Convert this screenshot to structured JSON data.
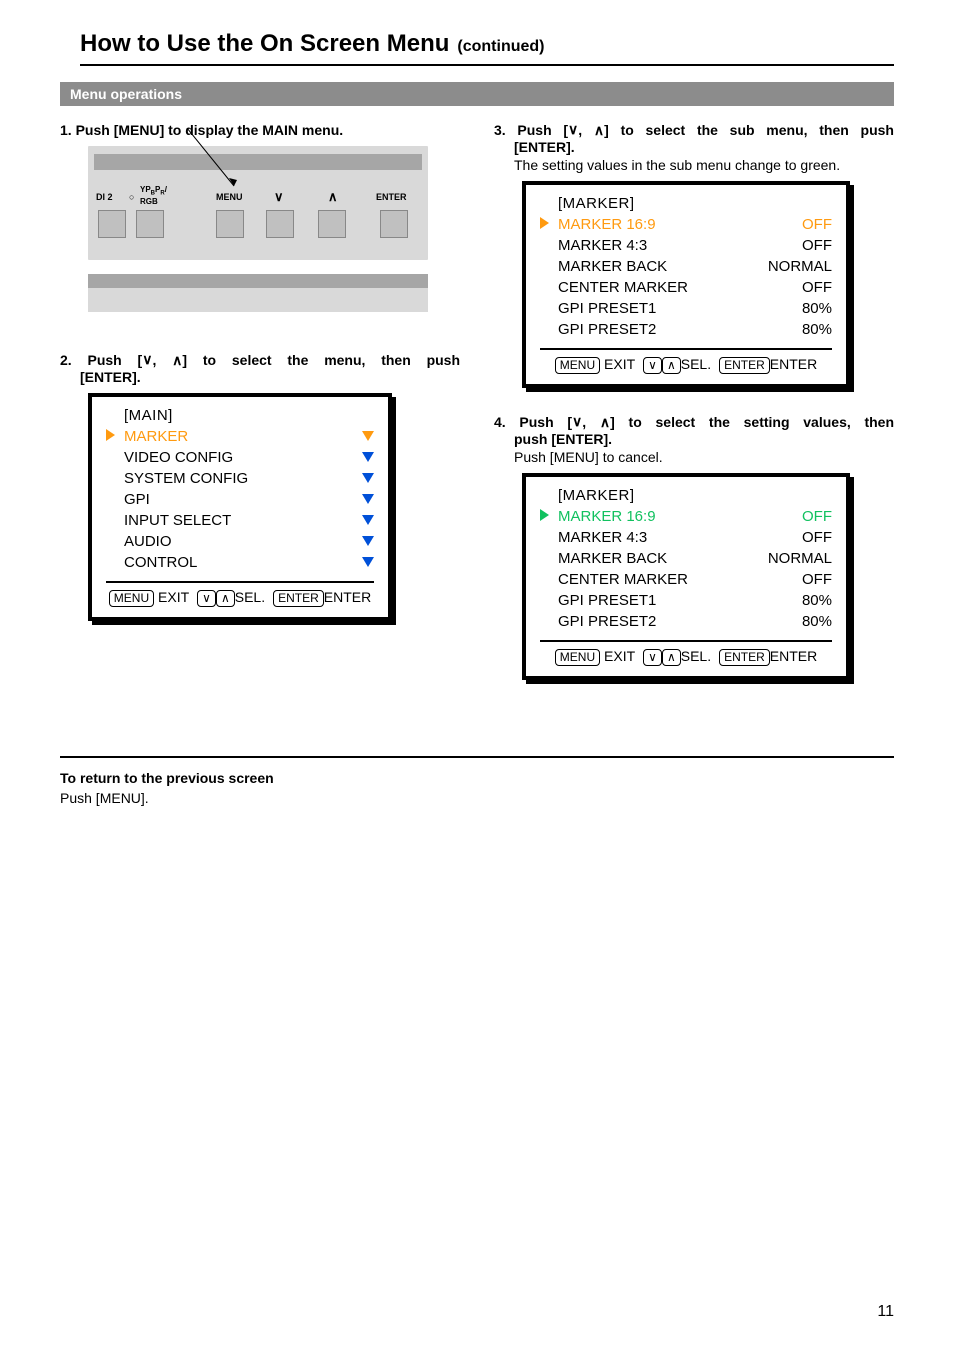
{
  "page_number": "11",
  "title": {
    "main": "How to Use the On Screen Menu",
    "continued": "(continued)"
  },
  "section_bar": "Menu operations",
  "steps": {
    "s1": {
      "num": "1.",
      "text": "Push [MENU] to display the MAIN menu."
    },
    "s2": {
      "num": "2.",
      "pre": "Push [",
      "mid": ",  ",
      "post": "] to select the menu, then push [ENTER]."
    },
    "s3": {
      "num": "3.",
      "pre": "Push [",
      "mid": ", ",
      "post": "] to select the sub menu, then push [ENTER].",
      "body": "The setting values in the sub menu change to green."
    },
    "s4": {
      "num": "4.",
      "pre": "Push [",
      "mid": ", ",
      "post": "] to select the setting values, then push [ENTER].",
      "body": "Push [MENU] to cancel."
    }
  },
  "hardware": {
    "labels": {
      "sdi2": "DI 2",
      "rgb_top": "YP",
      "rgb_b": "B",
      "rgb_p": "P",
      "rgb_r": "R",
      "rgb_slash": "/",
      "rgb_bot": "RGB",
      "menu": "MENU",
      "enter": "ENTER",
      "down": "∨",
      "up": "∧",
      "circle": "○"
    }
  },
  "osd_main": {
    "title": "[MAIN]",
    "items": [
      {
        "label": "MARKER",
        "sel": true
      },
      {
        "label": "VIDEO CONFIG"
      },
      {
        "label": "SYSTEM CONFIG"
      },
      {
        "label": "GPI"
      },
      {
        "label": "INPUT SELECT"
      },
      {
        "label": "AUDIO"
      },
      {
        "label": "CONTROL"
      }
    ],
    "footer": {
      "menu": "MENU",
      "exit": "EXIT",
      "v": "∨",
      "up": "∧",
      "sel": "SEL.",
      "enterkey": "ENTER",
      "enter": "ENTER"
    }
  },
  "osd_sub": {
    "title": "[MARKER]",
    "items": [
      {
        "label": "MARKER 16:9",
        "val": "OFF",
        "sel": true
      },
      {
        "label": "MARKER 4:3",
        "val": "OFF"
      },
      {
        "label": "MARKER BACK",
        "val": "NORMAL"
      },
      {
        "label": "CENTER MARKER",
        "val": "OFF"
      },
      {
        "label": "GPI PRESET1",
        "val": "80%"
      },
      {
        "label": "GPI PRESET2",
        "val": "80%"
      }
    ],
    "footer": {
      "menu": "MENU",
      "exit": "EXIT",
      "v": "∨",
      "up": "∧",
      "sel": "SEL.",
      "enterkey": "ENTER",
      "enter": "ENTER"
    }
  },
  "return": {
    "head": "To return to the previous screen",
    "body": "Push [MENU]."
  }
}
